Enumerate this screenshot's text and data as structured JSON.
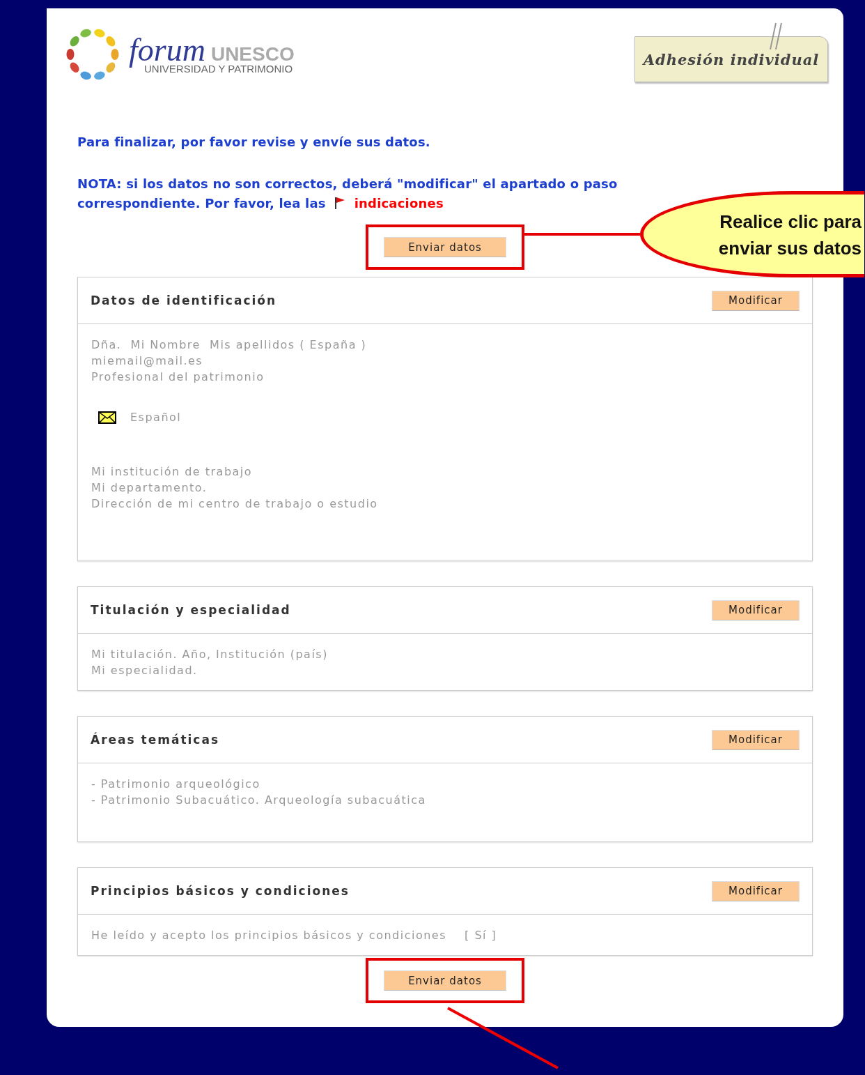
{
  "logo": {
    "word": "forum",
    "brand": "UNESCO",
    "tagline": "UNIVERSIDAD Y PATRIMONIO"
  },
  "page_tag": "Adhesión individual",
  "intro": "Para finalizar, por favor revise y envíe sus datos.",
  "note": {
    "text": "NOTA: si los datos no son correctos, deberá \"modificar\" el apartado o paso correspondiente. Por favor, lea las",
    "link": "indicaciones"
  },
  "submit_top": {
    "label": "Enviar datos",
    "highlighted": true
  },
  "callout": "Realice clic para enviar sus datos",
  "sections": [
    {
      "title": "Datos de identificación",
      "button": "Modificar",
      "blocks": [
        {
          "kind": "lines",
          "lines": [
            "Dña.  Mi Nombre  Mis apellidos ( España )",
            "miemail@mail.es",
            "Profesional del patrimonio"
          ]
        },
        {
          "kind": "language",
          "text": "Español"
        },
        {
          "kind": "lines",
          "lines": [
            "Mi institución de trabajo",
            "Mi departamento.",
            "Dirección de mi centro de trabajo o estudio"
          ]
        }
      ]
    },
    {
      "title": "Titulación y especialidad",
      "button": "Modificar",
      "blocks": [
        {
          "kind": "lines",
          "lines": [
            "Mi titulación. Año, Institución (país)",
            "Mi especialidad."
          ]
        }
      ]
    },
    {
      "title": "Áreas temáticas",
      "button": "Modificar",
      "blocks": [
        {
          "kind": "lines",
          "lines": [
            "- Patrimonio arqueológico",
            "- Patrimonio Subacuático. Arqueología subacuática"
          ]
        }
      ]
    },
    {
      "title": "Principios básicos y condiciones",
      "button": "Modificar",
      "blocks": [
        {
          "kind": "answer",
          "text": "He leído y acepto los principios básicos y condiciones",
          "value": "[ Sí ]"
        }
      ]
    }
  ],
  "submit_bottom": {
    "label": "Enviar datos",
    "highlighted": true
  }
}
